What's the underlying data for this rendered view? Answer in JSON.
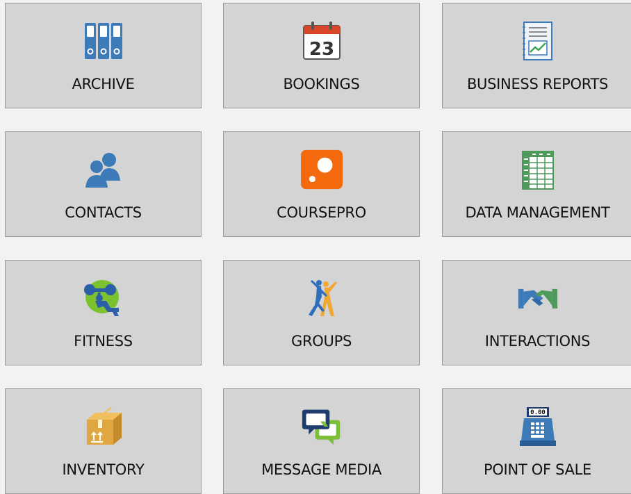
{
  "tiles": [
    {
      "label": "ARCHIVE",
      "icon": "binders-icon"
    },
    {
      "label": "BOOKINGS",
      "icon": "calendar-icon",
      "date": "23"
    },
    {
      "label": "BUSINESS REPORTS",
      "icon": "report-chart-icon"
    },
    {
      "label": "CONTACTS",
      "icon": "people-icon"
    },
    {
      "label": "COURSEPRO",
      "icon": "coursepro-logo-icon"
    },
    {
      "label": "DATA MANAGEMENT",
      "icon": "spreadsheet-icon"
    },
    {
      "label": "FITNESS",
      "icon": "weightlifter-icon"
    },
    {
      "label": "GROUPS",
      "icon": "dancers-icon"
    },
    {
      "label": "INTERACTIONS",
      "icon": "handshake-icon"
    },
    {
      "label": "INVENTORY",
      "icon": "package-box-icon"
    },
    {
      "label": "MESSAGE MEDIA",
      "icon": "chat-bubbles-icon"
    },
    {
      "label": "POINT OF SALE",
      "icon": "cash-register-icon",
      "display": "0.00"
    }
  ],
  "colors": {
    "tile_bg": "#d4d4d4",
    "tile_border": "#9a9a9a",
    "page_bg": "#f2f2f2",
    "blue_icon": "#3d7ab8",
    "orange": "#f26a0d",
    "green": "#4e9a5a"
  }
}
